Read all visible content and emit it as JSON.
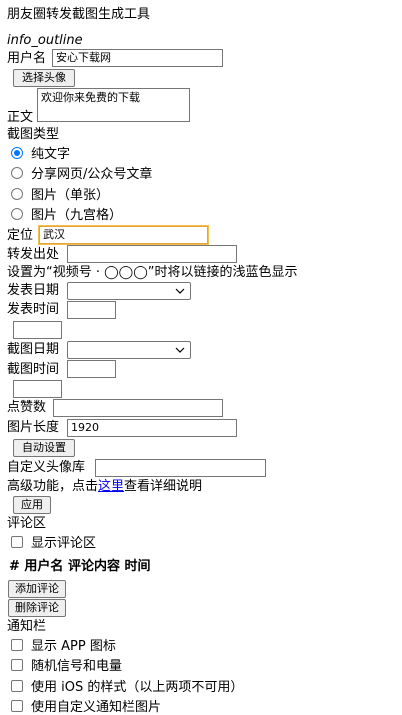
{
  "page_title": "朋友圈转发截图生成工具",
  "info_icon_text": "info_outline",
  "username": {
    "label": "用户名",
    "value": "安心下载网",
    "avatar_button": "选择头像"
  },
  "body": {
    "label": "正文",
    "value": "欢迎你来免费的下载"
  },
  "screenshot_type": {
    "label": "截图类型",
    "options": [
      {
        "label": "纯文字",
        "checked": true
      },
      {
        "label": "分享网页/公众号文章",
        "checked": false
      },
      {
        "label": "图片（单张）",
        "checked": false
      },
      {
        "label": "图片（九宫格）",
        "checked": false
      }
    ]
  },
  "location": {
    "label": "定位",
    "value": "武汉"
  },
  "source": {
    "label": "转发出处",
    "value": ""
  },
  "hint_text": "设置为“视频号 · ◯◯◯”时将以链接的浅蓝色显示",
  "publish_date": {
    "label": "发表日期",
    "value": ""
  },
  "publish_time": {
    "label": "发表时间",
    "value": ""
  },
  "capture_date": {
    "label": "截图日期",
    "value": ""
  },
  "capture_time": {
    "label": "截图时间",
    "value": ""
  },
  "likes": {
    "label": "点赞数",
    "value": ""
  },
  "image_length": {
    "label": "图片长度",
    "value": "1920",
    "auto_button": "自动设置"
  },
  "avatar_library": {
    "label": "自定义头像库",
    "value": ""
  },
  "advanced": {
    "prefix": "高级功能，点击",
    "link": "这里",
    "suffix": "查看详细说明",
    "apply_button": "应用"
  },
  "comments": {
    "label": "评论区",
    "show_label": "显示评论区",
    "show_checked": false,
    "header": "# 用户名 评论内容 时间",
    "add_button": "添加评论",
    "delete_button": "删除评论"
  },
  "notification_bar": {
    "label": "通知栏",
    "options": [
      {
        "label": "显示 APP 图标",
        "checked": false
      },
      {
        "label": "随机信号和电量",
        "checked": false
      },
      {
        "label": "使用 iOS 的样式（以上两项不可用）",
        "checked": false
      },
      {
        "label": "使用自定义通知栏图片",
        "checked": false
      }
    ]
  },
  "colors": {
    "link": "#0000ee",
    "radio_checked": "#0075ff",
    "focus_outline": "#f0c14b"
  }
}
